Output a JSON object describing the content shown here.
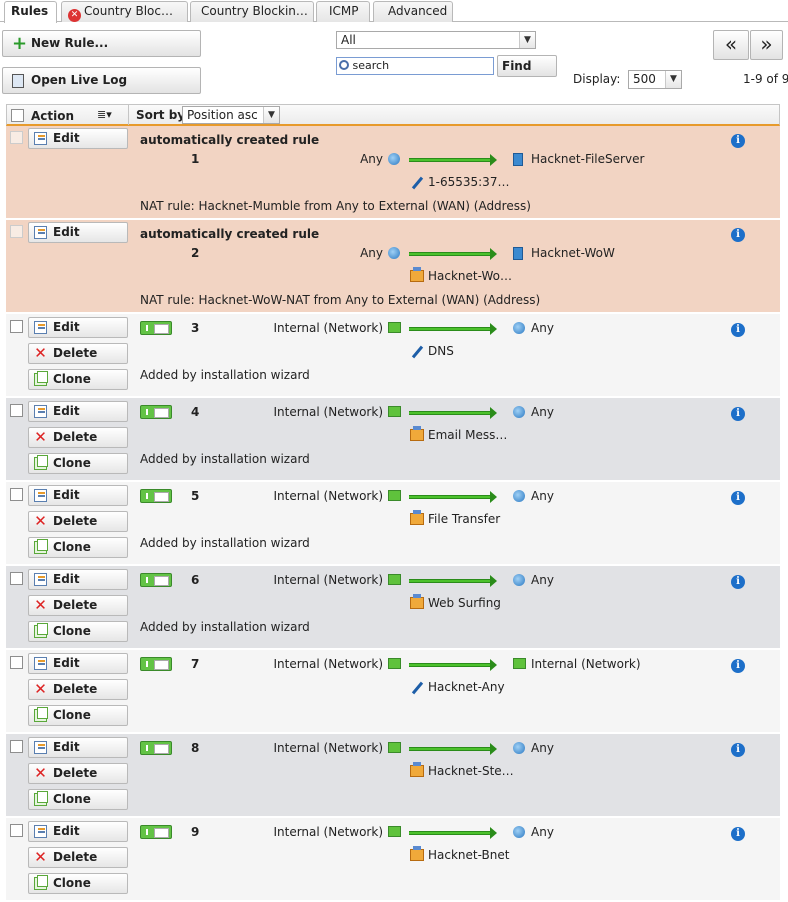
{
  "tabs": [
    {
      "label": "Rules",
      "active": true
    },
    {
      "label": "Country Bloc…",
      "icon": "error-icon"
    },
    {
      "label": "Country Blockin…"
    },
    {
      "label": "ICMP"
    },
    {
      "label": "Advanced"
    }
  ],
  "toolbar": {
    "new_rule": "New Rule...",
    "open_live_log": "Open Live Log",
    "filter_value": "All",
    "search_placeholder": "search",
    "find": "Find",
    "display_label": "Display:",
    "display_value": "500",
    "paging": "1-9 of 9",
    "prev": "«",
    "next": "»"
  },
  "table_header": {
    "action": "Action",
    "sort_by_label": "Sort by:",
    "sort_by_value": "Position asc"
  },
  "buttons": {
    "edit": "Edit",
    "delete": "Delete",
    "clone": "Clone"
  },
  "colors": {
    "nat_row": "#f2d4c3",
    "alt_row": "#e1e2e5",
    "accent": "#e79a2b",
    "enabled_toggle": "#63c346",
    "info": "#1d6fc9"
  },
  "rules": [
    {
      "number": "1",
      "type": "nat",
      "title": "automatically created rule",
      "source": "Any",
      "source_icon": "globe-icon",
      "destination": "Hacknet-FileServer",
      "destination_icon": "server-icon",
      "service": "1-65535:37…",
      "service_icon": "tool-icon",
      "note": "NAT rule: Hacknet-Mumble from Any to External (WAN) (Address)"
    },
    {
      "number": "2",
      "type": "nat",
      "title": "automatically created rule",
      "source": "Any",
      "source_icon": "globe-icon",
      "destination": "Hacknet-WoW",
      "destination_icon": "server-icon",
      "service": "Hacknet-Wo…",
      "service_icon": "service-box-icon",
      "note": "NAT rule: Hacknet-WoW-NAT from Any to External (WAN) (Address)"
    },
    {
      "number": "3",
      "type": "rule",
      "source": "Internal (Network)",
      "source_icon": "network-flag-icon",
      "destination": "Any",
      "destination_icon": "globe-icon",
      "service": "DNS",
      "service_icon": "tool-icon",
      "note": "Added by installation wizard"
    },
    {
      "number": "4",
      "type": "rule",
      "source": "Internal (Network)",
      "source_icon": "network-flag-icon",
      "destination": "Any",
      "destination_icon": "globe-icon",
      "service": "Email Mess…",
      "service_icon": "service-box-icon",
      "note": "Added by installation wizard"
    },
    {
      "number": "5",
      "type": "rule",
      "source": "Internal (Network)",
      "source_icon": "network-flag-icon",
      "destination": "Any",
      "destination_icon": "globe-icon",
      "service": "File Transfer",
      "service_icon": "service-box-icon",
      "note": "Added by installation wizard"
    },
    {
      "number": "6",
      "type": "rule",
      "source": "Internal (Network)",
      "source_icon": "network-flag-icon",
      "destination": "Any",
      "destination_icon": "globe-icon",
      "service": "Web Surfing",
      "service_icon": "service-box-icon",
      "note": "Added by installation wizard"
    },
    {
      "number": "7",
      "type": "rule",
      "source": "Internal (Network)",
      "source_icon": "network-flag-icon",
      "destination": "Internal (Network)",
      "destination_icon": "network-flag-icon",
      "service": "Hacknet-Any",
      "service_icon": "tool-icon",
      "note": ""
    },
    {
      "number": "8",
      "type": "rule",
      "source": "Internal (Network)",
      "source_icon": "network-flag-icon",
      "destination": "Any",
      "destination_icon": "globe-icon",
      "service": "Hacknet-Ste…",
      "service_icon": "service-box-icon",
      "note": ""
    },
    {
      "number": "9",
      "type": "rule",
      "source": "Internal (Network)",
      "source_icon": "network-flag-icon",
      "destination": "Any",
      "destination_icon": "globe-icon",
      "service": "Hacknet-Bnet",
      "service_icon": "service-box-icon",
      "note": ""
    }
  ]
}
